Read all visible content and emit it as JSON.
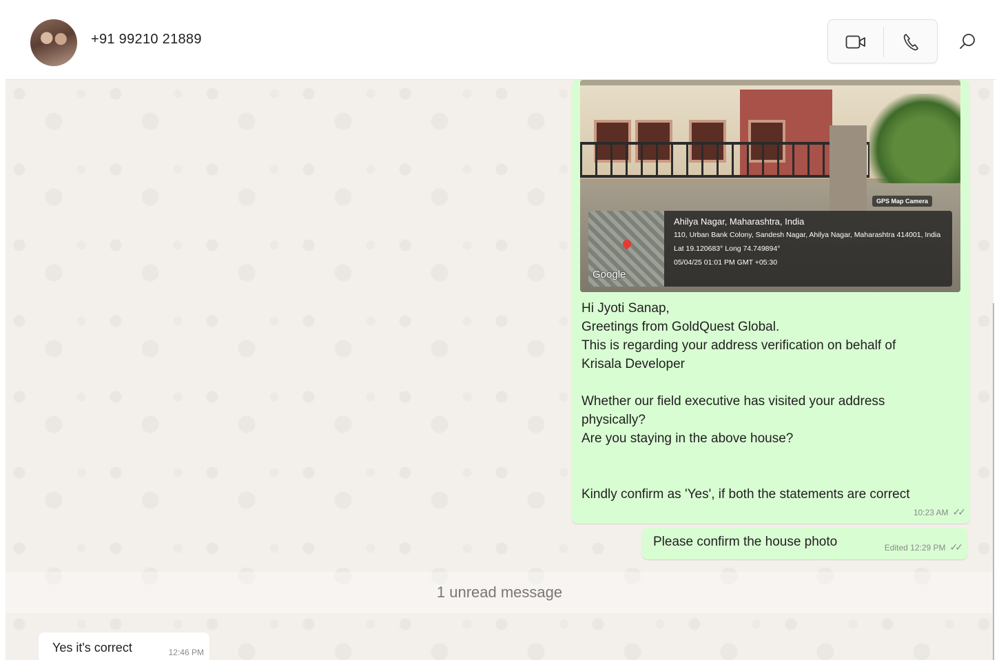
{
  "header": {
    "contact_name": "+91 99210 21889",
    "icons": {
      "video": "video-camera-icon",
      "voice": "phone-icon",
      "search": "search-icon"
    }
  },
  "messages": {
    "photo": {
      "gps_badge": "GPS Map Camera",
      "google_label": "Google",
      "location_title": "Ahilya Nagar, Maharashtra, India",
      "address_line": "110, Urban Bank Colony, Sandesh Nagar, Ahilya Nagar, Maharashtra 414001, India",
      "coords": "Lat 19.120683° Long 74.749894°",
      "datetime": "05/04/25 01:01 PM GMT +05:30"
    },
    "main_text": "Hi Jyoti Sanap,\nGreetings from GoldQuest Global.\nThis is regarding your address verification on behalf of\nKrisala Developer\n\nWhether our field executive has visited your address\nphysically?\nAre you staying in the above house?\n\n\nKindly confirm as 'Yes', if both the statements are correct",
    "main_time": "10:23 AM",
    "second_text": "Please confirm the house photo",
    "second_time": "Edited 12:29 PM",
    "unread_divider": "1 unread message",
    "incoming_text": "Yes it's correct",
    "incoming_time": "12:46 PM"
  },
  "colors": {
    "outgoing_bubble": "#d9fdd3",
    "incoming_bubble": "#ffffff",
    "chat_background": "#f3efea"
  }
}
